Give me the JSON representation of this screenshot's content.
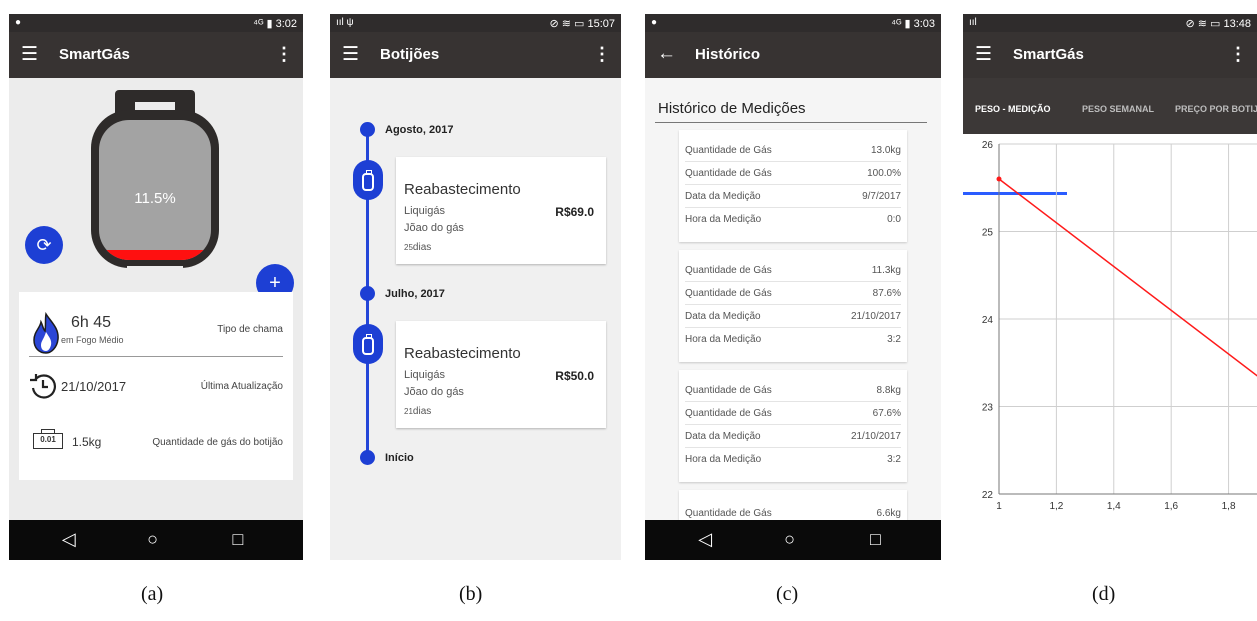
{
  "captions": [
    "(a)",
    "(b)",
    "(c)",
    "(d)"
  ],
  "colors": {
    "appbar": "#373332",
    "statusbar": "#2f2c2c",
    "accent": "#1d3fd4",
    "danger": "#ff1010",
    "chart_line": "#ff1a1a"
  },
  "navbar": {
    "back": "◁",
    "home": "○",
    "recent": "□"
  },
  "screen_a": {
    "status": {
      "left": "●",
      "right": "⁴ᴳ ▮ 3:02"
    },
    "title": "SmartGás",
    "gas_percent_label": "11.5%",
    "gas_percent_value": 11.5,
    "icons": [
      "menu-icon",
      "overflow-icon",
      "refresh-icon",
      "add-icon",
      "flame-icon",
      "history-icon",
      "scale-icon"
    ],
    "refresh_glyph": "⟳",
    "add_glyph": "+",
    "scale_glyph": "0.01",
    "duration": "6h 45",
    "fire_level": "em Fogo Médio",
    "flame_type_label": "Tipo de chama",
    "last_date": "21/10/2017",
    "last_update_label": "Última Atualização",
    "weight": "1.5kg",
    "gas_qty_label": "Quantidade de gás do botijão"
  },
  "screen_b": {
    "status": {
      "left": "ııl ψ",
      "right": "⊘ ≋ ▭ 15:07"
    },
    "title": "Botijões",
    "months": [
      "Agosto, 2017",
      "Julho, 2017"
    ],
    "start_label": "Início",
    "refills": [
      {
        "title": "Reabastecimento",
        "brand": "Liquigás",
        "seller": "Jõao do gás",
        "price": "R$69.0",
        "days_num": "25",
        "days_unit": "dias"
      },
      {
        "title": "Reabastecimento",
        "brand": "Liquigás",
        "seller": "Jõao do gás",
        "price": "R$50.0",
        "days_num": "21",
        "days_unit": "dias"
      }
    ]
  },
  "screen_c": {
    "status": {
      "left": "●",
      "right": "⁴ᴳ ▮ 3:03"
    },
    "title": "Histórico",
    "heading": "Histórico de Medições",
    "labels": {
      "kg": "Quantidade de Gás",
      "pct": "Quantidade de Gás",
      "date": "Data da Medição",
      "time": "Hora da Medição"
    },
    "measurements": [
      {
        "kg": "13.0kg",
        "pct": "100.0%",
        "date": "9/7/2017",
        "time": "0:0"
      },
      {
        "kg": "11.3kg",
        "pct": "87.6%",
        "date": "21/10/2017",
        "time": "3:2"
      },
      {
        "kg": "8.8kg",
        "pct": "67.6%",
        "date": "21/10/2017",
        "time": "3:2"
      },
      {
        "kg": "6.6kg"
      }
    ]
  },
  "screen_d": {
    "status": {
      "left": "ııl",
      "right": "⊘ ≋ ▭ 13:48"
    },
    "title": "SmartGás",
    "tabs": [
      "PESO - MEDIÇÃO",
      "PESO SEMANAL",
      "PREÇO POR BOTIJ"
    ],
    "chart_data": {
      "type": "line",
      "x_ticks": [
        "1",
        "1,2",
        "1,4",
        "1,6",
        "1,8"
      ],
      "y_ticks": [
        "22",
        "23",
        "24",
        "25",
        "26"
      ],
      "xlim": [
        1,
        1.92
      ],
      "ylim": [
        22,
        26
      ],
      "series": [
        {
          "x": [
            1,
            1.92
          ],
          "y": [
            25.6,
            23.3
          ]
        }
      ],
      "grid": true
    }
  }
}
